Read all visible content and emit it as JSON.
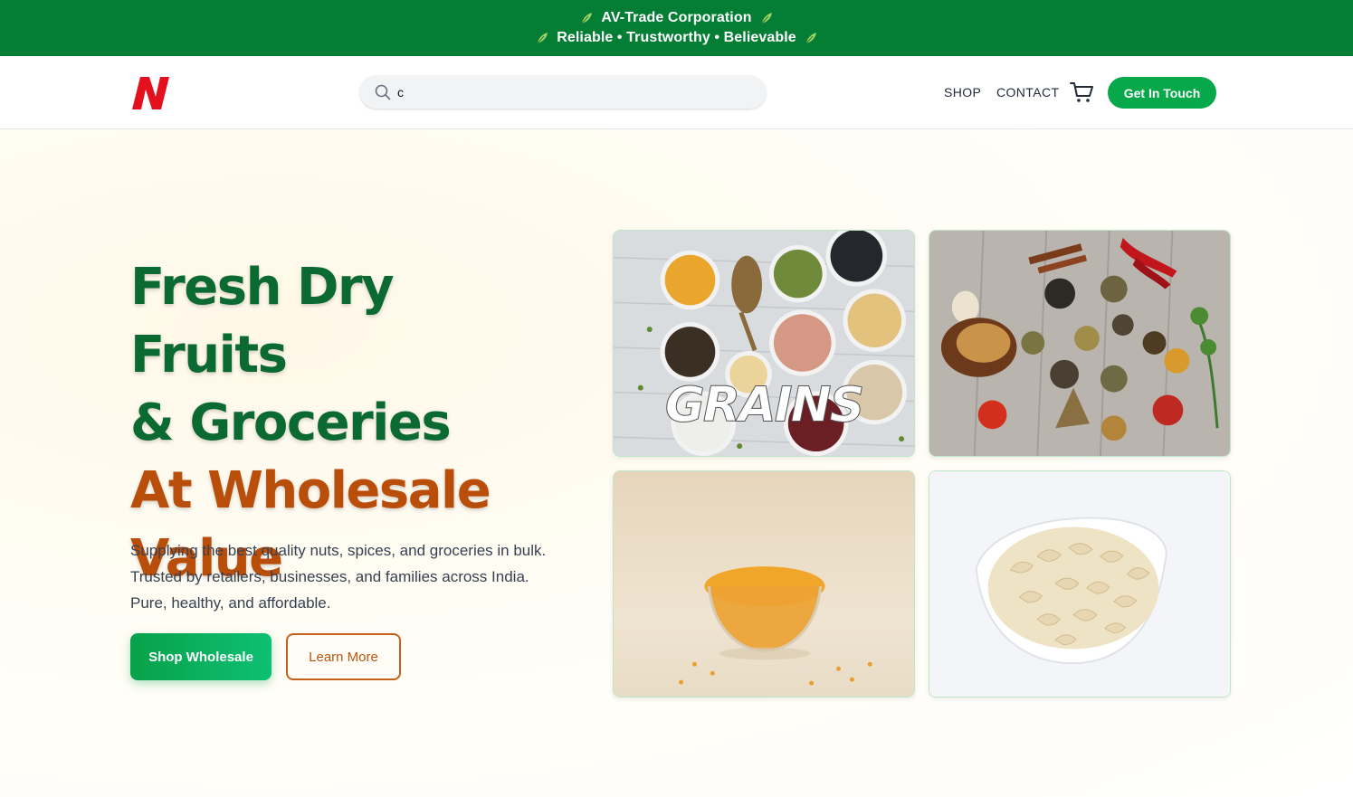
{
  "banner": {
    "line1": "AV-Trade Corporation",
    "line2": "Reliable • Trustworthy • Believable",
    "bg_color": "#047e35",
    "icon": "leaf-icon"
  },
  "header": {
    "logo_icon": "n-logo-icon",
    "search": {
      "value": "c",
      "icon": "search-icon"
    },
    "nav": {
      "shop": "SHOP",
      "contact": "CONTACT"
    },
    "cart_icon": "cart-icon",
    "cta_label": "Get In Touch",
    "cta_color": "#07a84a"
  },
  "hero": {
    "headline_line1": "Fresh Dry Fruits",
    "headline_line2": "& Groceries",
    "headline_line3": "At Wholesale",
    "headline_line4": "Value",
    "headline_green": "#0b6a31",
    "headline_orange": "#b94e0b",
    "description": "Supplying the best quality nuts, spices, and groceries in bulk. Trusted by retailers, businesses, and families across India. Pure, healthy, and affordable.",
    "primary_button": "Shop Wholesale",
    "secondary_button": "Learn More"
  },
  "gallery": {
    "tiles": [
      {
        "name": "grains-image",
        "label": "GRAINS"
      },
      {
        "name": "spices-image"
      },
      {
        "name": "lentils-bowl-image"
      },
      {
        "name": "cashews-bowl-image"
      }
    ]
  }
}
